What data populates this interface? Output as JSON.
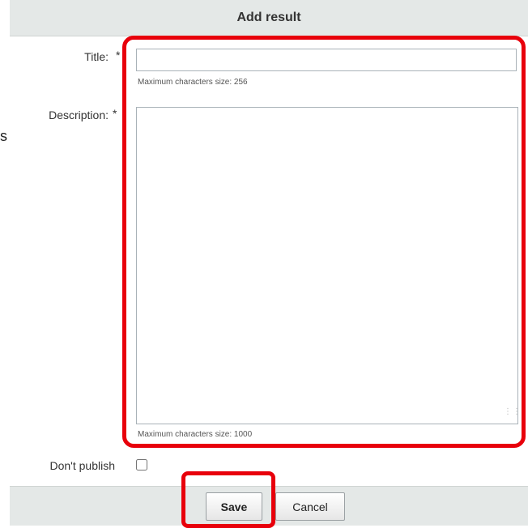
{
  "dialog": {
    "title": "Add result"
  },
  "stray_glyph": "s",
  "form": {
    "title_label": "Title:",
    "title_required": "*",
    "title_value": "",
    "title_hint": "Maximum characters size: 256",
    "description_label": "Description:",
    "description_required": "*",
    "description_value": "",
    "description_hint": "Maximum characters size: 1000",
    "dont_publish_label": "Don't publish",
    "dont_publish_checked": false
  },
  "buttons": {
    "save_label": "Save",
    "cancel_label": "Cancel"
  },
  "highlight": {
    "color": "#e8000b"
  }
}
